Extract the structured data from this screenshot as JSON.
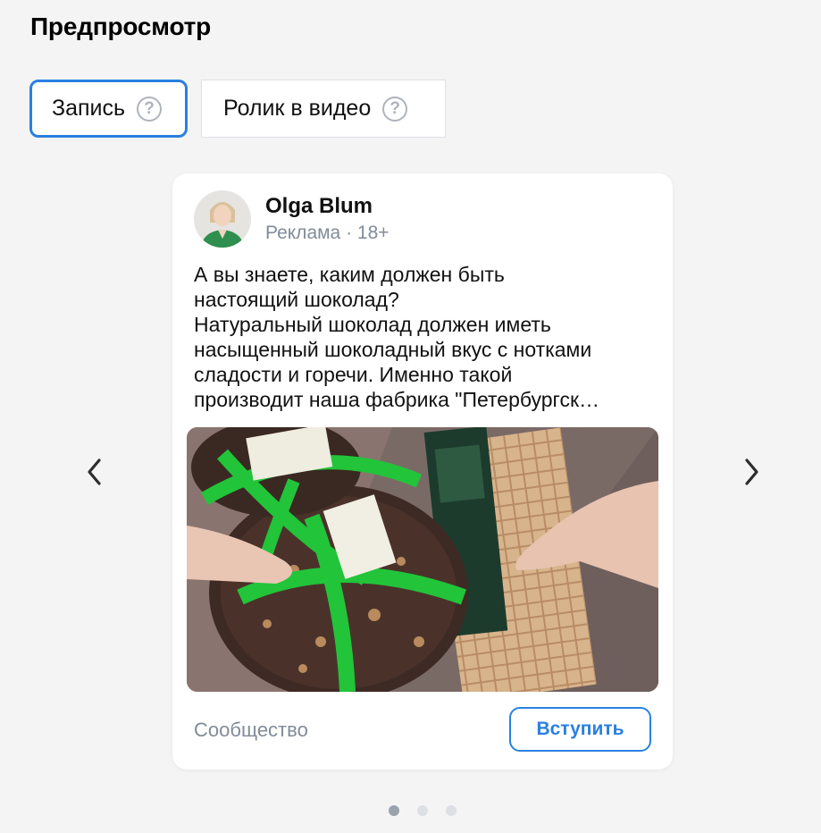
{
  "page": {
    "title": "Предпросмотр"
  },
  "tabs": [
    {
      "label": "Запись",
      "active": true,
      "help_icon": "question-circle-icon"
    },
    {
      "label": "Ролик в видео",
      "active": false,
      "help_icon": "question-circle-icon"
    }
  ],
  "carousel": {
    "prev_icon": "chevron-left-icon",
    "next_icon": "chevron-right-icon",
    "total_slides": 3,
    "active_slide": 1
  },
  "post": {
    "author_name": "Olga Blum",
    "author_meta": "Реклама · 18+",
    "text_lines": [
      "А вы знаете, каким должен быть",
      "настоящий шоколад?",
      "Натуральный шоколад должен иметь",
      "насыщенный шоколадный вкус с нотками",
      "сладости и горечи. Именно такой",
      "производит наша фабрика \"Петербургск…"
    ],
    "footer_label": "Сообщество",
    "join_button_label": "Вступить"
  },
  "colors": {
    "accent": "#2a80e0",
    "muted_text": "#818c99",
    "background": "#f4f4f5"
  }
}
